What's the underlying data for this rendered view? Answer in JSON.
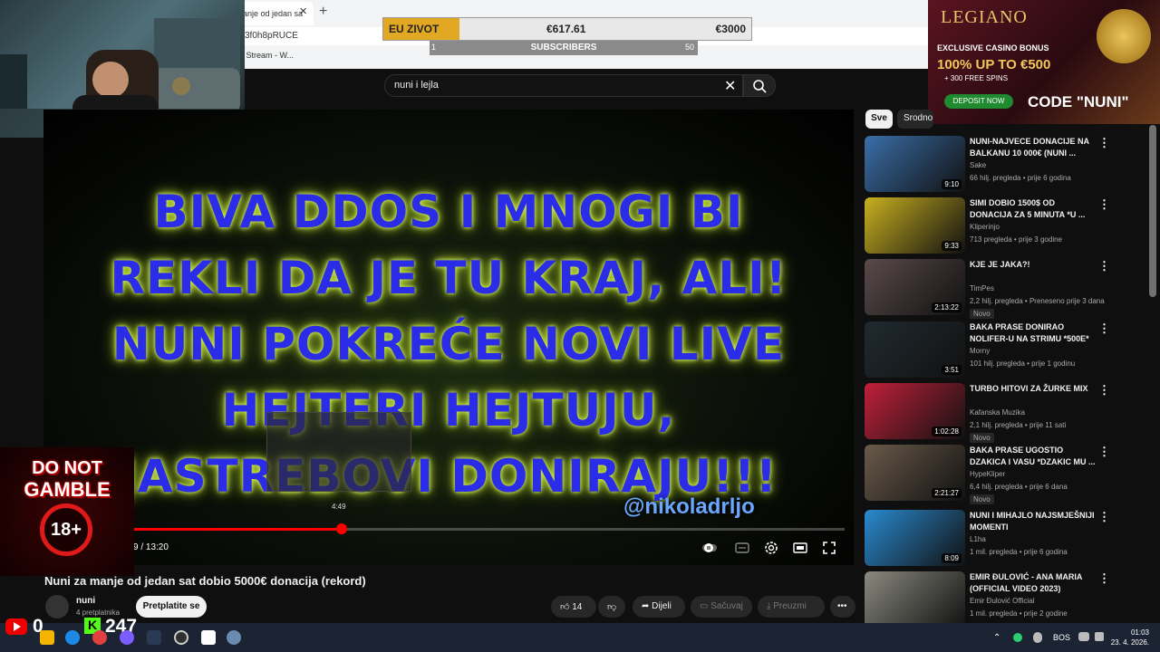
{
  "browser": {
    "tab_title": "anje od jedan sa",
    "url_fragment": "3f0h8pRUCE",
    "bookmark": "yt Stream - W..."
  },
  "goal": {
    "label": "EU ZIVOT",
    "current": "€617.61",
    "target": "€3000",
    "progress_fraction": 0.206,
    "subs_label": "SUBSCRIBERS",
    "subs_min": "1",
    "subs_max": "50"
  },
  "ad": {
    "brand": "LEGIANO",
    "line1": "EXCLUSIVE CASINO BONUS",
    "line2": "100% UP TO €500",
    "line3": "+ 300 FREE SPINS",
    "button": "DEPOSIT NOW",
    "code": "CODE \"NUNI\""
  },
  "search": {
    "query": "nuni i lejla"
  },
  "video": {
    "lines": [
      "BIVA DDOS I MNOGI BI",
      "REKLI DA JE TU KRAJ, ALI!",
      "NUNI POKREĆE NOVI LIVE",
      "HEJTERI HEJTUJU,",
      "JASTREBOVI DONIRAJU!!!"
    ],
    "watermark": "@nikoladrljo",
    "preview_time": "4:49",
    "time_display": "9 / 13:20",
    "progress_fraction": 0.291
  },
  "gamble": {
    "line1": "DO NOT",
    "line2": "GAMBLE",
    "line3": "18+"
  },
  "info": {
    "title": "Nuni za manje od jedan sat dobio 5000€ donacija (rekord)",
    "channel": "nuni",
    "subscribers": "4 pretplatnika",
    "subscribe": "Pretplatite se",
    "likes": "14",
    "share": "Dijeli",
    "save": "Sačuvaj",
    "download": "Preuzmi"
  },
  "sidebar": {
    "chip_all": "Sve",
    "chip_related": "Srodno",
    "items": [
      {
        "title": "NUNI-NAJVECE DONACIJE NA BALKANU 10 000€ (NUNI ...",
        "channel": "Sake",
        "meta": "66 hilj. pregleda • prije 6 godina",
        "badge": "",
        "duration": "9:10",
        "thumb_color": "#3a6ea8"
      },
      {
        "title": "SIMI DOBIO 1500$ OD DONACIJA ZA 5 MINUTA *u ...",
        "channel": "Kliperinjo",
        "meta": "713 pregleda • prije 3 godine",
        "badge": "",
        "duration": "9:33",
        "thumb_color": "#c8b020"
      },
      {
        "title": "KJE JE JAKA?!",
        "channel": "TimPes",
        "meta": "2,2 hilj. pregleda • Preneseno prije 3 dana",
        "badge": "Novo",
        "duration": "2:13:22",
        "thumb_color": "#5a4a4a"
      },
      {
        "title": "BAKA PRASE DONIRAO NOLIFER-U NA STRIMU *500e*",
        "channel": "Morny",
        "meta": "101 hilj. pregleda • prije 1 godinu",
        "badge": "",
        "duration": "3:51",
        "thumb_color": "#202a30"
      },
      {
        "title": "TURBO HITOVI ZA ŽURKE MIX",
        "channel": "Kafanska Muzika",
        "meta": "2,1 hilj. pregleda • prije 11 sati",
        "badge": "Novo",
        "duration": "1:02:28",
        "thumb_color": "#c0203a"
      },
      {
        "title": "BAKA PRASE UGOSTIO DZAKICA I VASU *DZAKIC MU ...",
        "channel": "HypeKliper",
        "meta": "6,4 hilj. pregleda • prije 6 dana",
        "badge": "Novo",
        "duration": "2:21:27",
        "thumb_color": "#6a5a4a"
      },
      {
        "title": "NUNI I MIHAJLO NAJSMJEŠNIJI MOMENTI",
        "channel": "L1ha",
        "meta": "1 mil. pregleda • prije 6 godina",
        "badge": "",
        "duration": "8:09",
        "thumb_color": "#2a8ad0"
      },
      {
        "title": "EMIR ĐULOVIĆ - ANA MARIA (OFFICIAL VIDEO 2023)",
        "channel": "Emir Đulović Official",
        "meta": "1 mil. pregleda • prije 2 godine",
        "badge": "",
        "duration": "",
        "thumb_color": "#8a8a80"
      }
    ]
  },
  "taskbar": {
    "yt_count": "0",
    "kick_letter": "K",
    "kick_count": "247",
    "lang": "BOS",
    "time": "01:03",
    "date": "23. 4. 2026."
  }
}
